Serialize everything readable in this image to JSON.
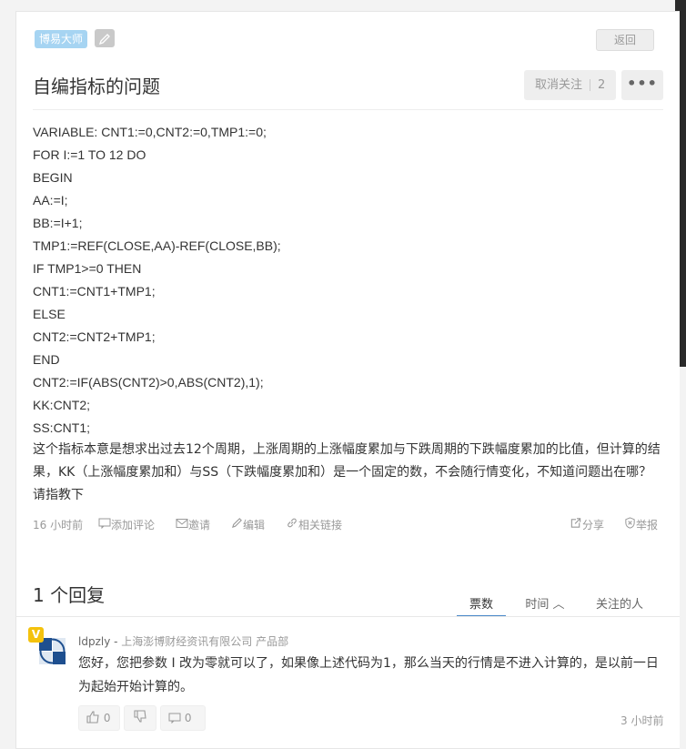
{
  "question": {
    "tag": "博易大师",
    "back_label": "返回",
    "title": "自编指标的问题",
    "unfollow_label": "取消关注",
    "follow_count": "2",
    "more_label": "•••",
    "code_lines": [
      "VARIABLE: CNT1:=0,CNT2:=0,TMP1:=0;",
      "FOR I:=1 TO 12 DO",
      "BEGIN",
      "AA:=I;",
      "BB:=I+1;",
      "TMP1:=REF(CLOSE,AA)-REF(CLOSE,BB);",
      "IF TMP1>=0 THEN",
      "CNT1:=CNT1+TMP1;",
      "ELSE",
      "CNT2:=CNT2+TMP1;",
      "END",
      "CNT2:=IF(ABS(CNT2)>0,ABS(CNT2),1);",
      "KK:CNT2;",
      "SS:CNT1;"
    ],
    "description": "这个指标本意是想求出过去12个周期，上涨周期的上涨幅度累加与下跌周期的下跌幅度累加的比值，但计算的结果，KK（上涨幅度累加和）与SS（下跌幅度累加和）是一个固定的数，不会随行情变化，不知道问题出在哪？请指教下",
    "meta": {
      "time": "16 小时前",
      "add_comment": "添加评论",
      "invite": "邀请",
      "edit": "编辑",
      "related_links": "相关链接",
      "share": "分享",
      "report": "举报"
    }
  },
  "answers": {
    "count_label": "1 个回复",
    "tabs": [
      "票数",
      "时间 ︿",
      "关注的人"
    ],
    "items": [
      {
        "badge": "V",
        "username": "ldpzly",
        "separator": " - ",
        "company": "上海澎博财经资讯有限公司 产品部",
        "content": "您好，您把参数 I 改为零就可以了，如果像上述代码为1，那么当天的行情是不进入计算的，是以前一日为起始开始计算的。",
        "likes": "0",
        "comments": "0",
        "time": "3 小时前"
      }
    ]
  },
  "icons": {
    "edit_tag": "pencil-icon",
    "comment": "comment-icon",
    "invite": "envelope-icon",
    "edit": "pencil-icon",
    "link": "link-icon",
    "share": "share-icon",
    "report": "shield-icon",
    "like": "thumbs-up-icon",
    "dislike": "thumbs-down-icon",
    "reply_comment": "comment-icon"
  },
  "colors": {
    "tag_bg": "#a6d4f2",
    "active_tab_underline": "#4b8ac9",
    "badge_bg": "#f4c20d"
  }
}
